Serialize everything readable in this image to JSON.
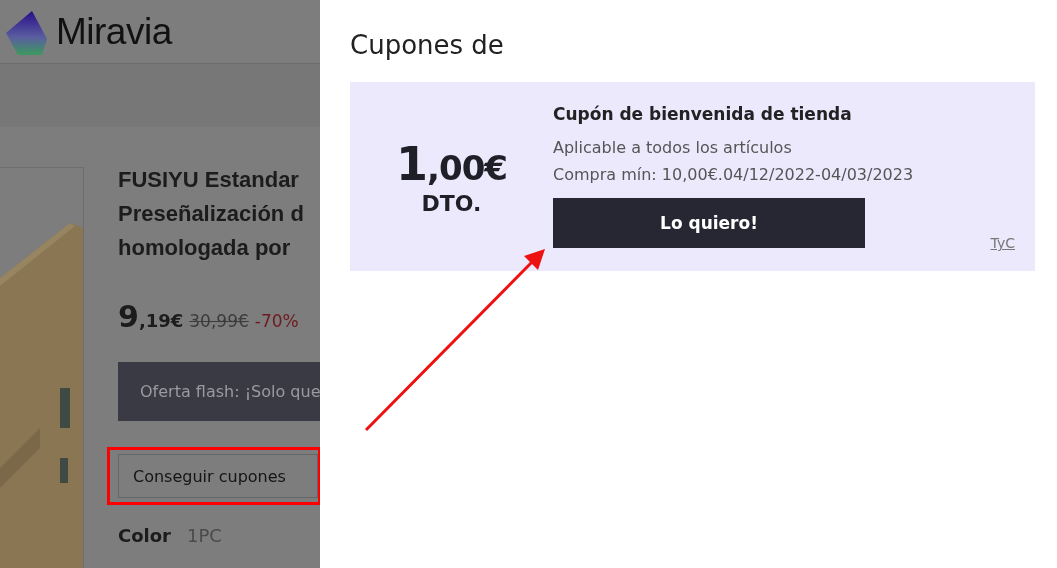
{
  "header": {
    "logo_text": "Miravia"
  },
  "product": {
    "title_lines": [
      "FUSIYU Estandar",
      "Preseñalización d",
      "homologada por"
    ],
    "price": {
      "integer": "9",
      "decimals": ",19€",
      "original": "30,99€",
      "discount": "-70%"
    },
    "flash_banner": "Oferta flash: ¡Solo que",
    "coupon_button": "Conseguir cupones",
    "option": {
      "label": "Color",
      "value": "1PC"
    }
  },
  "coupon_panel": {
    "title": "Cupones de",
    "coupons": [
      {
        "amount_integer": "1",
        "amount_decimals": ",00€",
        "amount_label": "DTO.",
        "name": "Cupón de bienvenida de tienda",
        "scope": "Aplicable a todos los artículos",
        "conditions": "Compra mín: 10,00€.04/12/2022-04/03/2023",
        "button": "Lo quiero!",
        "terms_link": "TyC"
      }
    ]
  }
}
